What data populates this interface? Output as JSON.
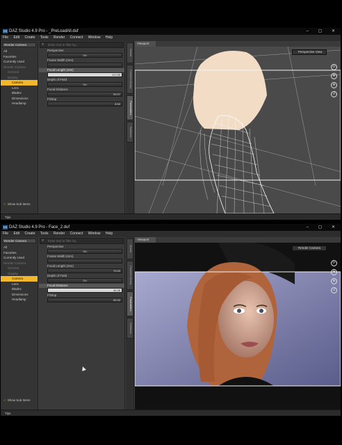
{
  "app": {
    "icon_label": "DS",
    "window_controls": "– ▢ ✕"
  },
  "windows": [
    {
      "title": "DAZ Studio 4.9 Pro - _PreLoadAll.duf",
      "menu": [
        "File",
        "Edit",
        "Create",
        "Tools",
        "Render",
        "Connect",
        "Window",
        "Help"
      ],
      "tree": {
        "dropdown": "Render Camera",
        "items": [
          {
            "label": "All"
          },
          {
            "label": "Favorites"
          },
          {
            "label": "Currently Used"
          },
          {
            "label": "Render Camera",
            "dim": true
          },
          {
            "label": "General",
            "dim": true
          },
          {
            "label": "Display",
            "dim": true
          },
          {
            "label": "Camera",
            "selected": true
          },
          {
            "label": "Lens"
          },
          {
            "label": "Blades"
          },
          {
            "label": "Dimensions"
          },
          {
            "label": "Headlamp"
          }
        ],
        "show_sub_items": "Show Sub Items"
      },
      "params": {
        "search_placeholder": "Enter text to filter by...",
        "perspective_label": "Perspective",
        "perspective_value": "On",
        "frame_width_label": "Frame Width (mm)",
        "focal_length_label": "Focal Length (mm)",
        "focal_length_value": "117.00",
        "dof_label": "Depth of Field",
        "dof_value": "On",
        "focal_distance_label": "Focal Distance",
        "focal_distance_value": "53.97",
        "fstop_label": "F/Stop",
        "fstop_value": "8.60"
      },
      "tabs": [
        "Scene",
        "Content Library",
        "Parameters",
        "Surfaces"
      ],
      "viewport": {
        "tab": "Viewport",
        "camera": "Perspective View"
      },
      "status": "Tips"
    },
    {
      "title": "DAZ Studio 4.9 Pro - Face_2.duf",
      "menu": [
        "File",
        "Edit",
        "Create",
        "Tools",
        "Render",
        "Connect",
        "Window",
        "Help"
      ],
      "tree": {
        "dropdown": "Render Camera",
        "items": [
          {
            "label": "All"
          },
          {
            "label": "Favorites"
          },
          {
            "label": "Currently Used"
          },
          {
            "label": "Render Camera",
            "dim": true
          },
          {
            "label": "General",
            "dim": true
          },
          {
            "label": "Display",
            "dim": true
          },
          {
            "label": "Camera",
            "selected": true
          },
          {
            "label": "Lens"
          },
          {
            "label": "Blades"
          },
          {
            "label": "Dimensions"
          },
          {
            "label": "Headlamp"
          }
        ],
        "show_sub_items": "Show Sub Items"
      },
      "params": {
        "search_placeholder": "Enter text to filter by...",
        "perspective_label": "Perspective",
        "perspective_value": "On",
        "frame_width_label": "Frame Width (mm)",
        "focal_length_label": "Focal Length (mm)",
        "focal_length_value": "70.00",
        "dof_label": "Depth of Field",
        "dof_value": "On",
        "focal_distance_label": "Focal Distance",
        "focal_distance_value": "40.28",
        "fstop_label": "F/Stop",
        "fstop_value": "60.00"
      },
      "tabs": [
        "Scene",
        "Content Library",
        "Parameters",
        "Surfaces"
      ],
      "viewport": {
        "tab": "Viewport",
        "camera": "Render Camera"
      },
      "status": "Tips"
    }
  ],
  "colors": {
    "selection": "#f2b72a",
    "panel": "#3a3a3a",
    "titlebar": "#0a0a0a"
  }
}
